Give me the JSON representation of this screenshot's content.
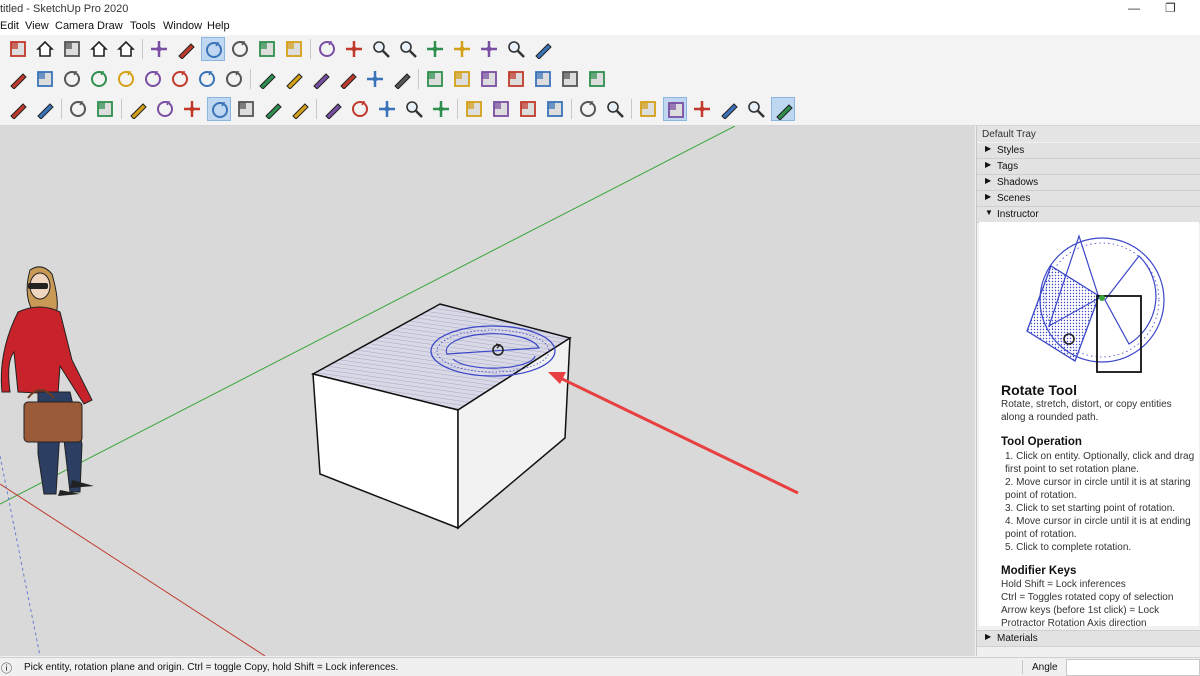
{
  "window": {
    "title": "titled - SketchUp Pro 2020",
    "minimize": "—",
    "maximize": "❐"
  },
  "menu": [
    "Edit",
    "View",
    "Camera",
    "Draw",
    "Tools",
    "Window",
    "Help"
  ],
  "toolbar": {
    "row1_icons": [
      "make-component",
      "house",
      "warehouse",
      "home-outline",
      "garage",
      "move",
      "push-pull",
      "rotate",
      "follow-me",
      "scale",
      "offset",
      "orbit",
      "pan",
      "zoom",
      "zoom-window",
      "zoom-extents",
      "previous",
      "position-camera",
      "look-around",
      "walk"
    ],
    "row2_icons": [
      "freehand",
      "rectangle",
      "rotated-rectangle",
      "circle",
      "polygon",
      "arc",
      "2-point-arc",
      "3-point-arc",
      "pie",
      "tape-measure",
      "dimensions",
      "protractor",
      "text",
      "axes",
      "3d-text",
      "section-plane",
      "display-section-planes",
      "display-section-cuts",
      "display-section-fill",
      "add-location",
      "toggle-terrain",
      "photo-textures"
    ],
    "row3_icons": [
      "eraser",
      "line",
      "arc-dropdown",
      "rectangle-dropdown",
      "push-pull",
      "follow-me",
      "move",
      "rotate",
      "scale",
      "tape-measure",
      "text",
      "paint-bucket",
      "orbit",
      "pan",
      "zoom",
      "zoom-extents",
      "3d-warehouse",
      "extension-warehouse",
      "send-to-layout",
      "extension-manager",
      "account",
      "sandbox",
      "solid-tools",
      "match-photo",
      "position-camera",
      "walk",
      "look-around",
      "advanced-camera"
    ]
  },
  "tray": {
    "title": "Default Tray",
    "panels": [
      {
        "label": "Styles",
        "expanded": false
      },
      {
        "label": "Tags",
        "expanded": false
      },
      {
        "label": "Shadows",
        "expanded": false
      },
      {
        "label": "Scenes",
        "expanded": false
      },
      {
        "label": "Instructor",
        "expanded": true
      }
    ],
    "materials": "Materials",
    "instructor": {
      "tool_name": "Rotate Tool",
      "description": "Rotate, stretch, distort, or copy entities along a rounded path.",
      "operation_heading": "Tool Operation",
      "steps": [
        "1. Click on entity. Optionally, click and drag first point to set rotation plane.",
        "2. Move cursor in circle until it is at staring point of rotation.",
        "3. Click to set starting point of rotation.",
        "4. Move cursor in circle until it is at ending point of rotation.",
        "5. Click to complete rotation."
      ],
      "modifier_heading": "Modifier Keys",
      "modifiers": [
        "Hold Shift = Lock inferences",
        "Ctrl = Toggles rotated copy of selection",
        "Arrow keys (before 1st click) = Lock Protractor Rotation Axis direction"
      ]
    }
  },
  "status": {
    "message": "Pick entity, rotation plane and origin.  Ctrl = toggle Copy, hold Shift = Lock inferences.",
    "measurement_label": "Angle",
    "measurement_value": ""
  },
  "colors": {
    "accent": "#1a6fc4",
    "active_tool": "#bfd7f0",
    "axis_red": "#c0392b",
    "axis_green": "#3aa53a",
    "protractor": "#3b47c8",
    "arrow": "#e84040"
  }
}
